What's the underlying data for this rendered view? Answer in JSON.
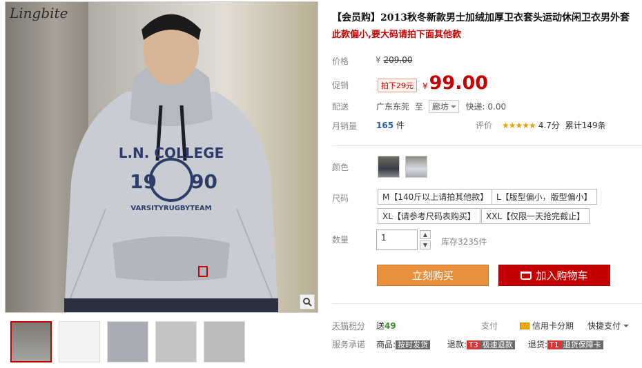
{
  "gallery": {
    "logo": "Lingbite",
    "zoom_icon": "magnifier-icon",
    "thumbnail_count": 5
  },
  "product": {
    "title": "【会员购】2013秋冬新款男士加绒加厚卫衣套头运动休闲卫衣男外套",
    "subtitle": "此款偏小,要大码请拍下面其他款",
    "labels": {
      "price": "价格",
      "promo": "促销",
      "ship": "配送",
      "monthly_sales": "月销量",
      "rating": "评价",
      "color": "颜色",
      "size": "尺码",
      "qty": "数量"
    },
    "original_price_currency": "¥",
    "original_price": "209.00",
    "promo_tag": "拍下29元",
    "price_currency": "¥",
    "price": "99.00",
    "ship_from": "广东东莞",
    "ship_to_label": "至",
    "ship_to": "廊坊",
    "express": "快递: 0.00",
    "monthly_sales_value": "165",
    "monthly_sales_unit": "件",
    "stars": "★★★★★",
    "rating_score": "4.7分",
    "rating_total": "累计149条",
    "sizes": [
      "M【140斤以上请拍其他款】",
      "L【版型偏小，版型偏小】",
      "XL【请参考尺码表购买】",
      "XXL【仅限一天抢完截止】"
    ],
    "qty_value": "1",
    "stock": "库存3235件",
    "buy_now": "立刻购买",
    "add_to_cart": "加入购物车"
  },
  "footer": {
    "tmall_points_label": "天猫积分",
    "points_prefix": "送",
    "points_value": "49",
    "pay_label": "支付",
    "credit_card": "信用卡分期",
    "quick_pay": "快捷支付",
    "service_label": "服务承诺",
    "goods_label": "商品:",
    "goods_badge": "按时发货",
    "refund_label": "退款:",
    "refund_badge_tag": "T3",
    "refund_badge": "极速退款",
    "return_label": "退货:",
    "return_badge_tag": "T1",
    "return_badge": "退货保障卡"
  }
}
